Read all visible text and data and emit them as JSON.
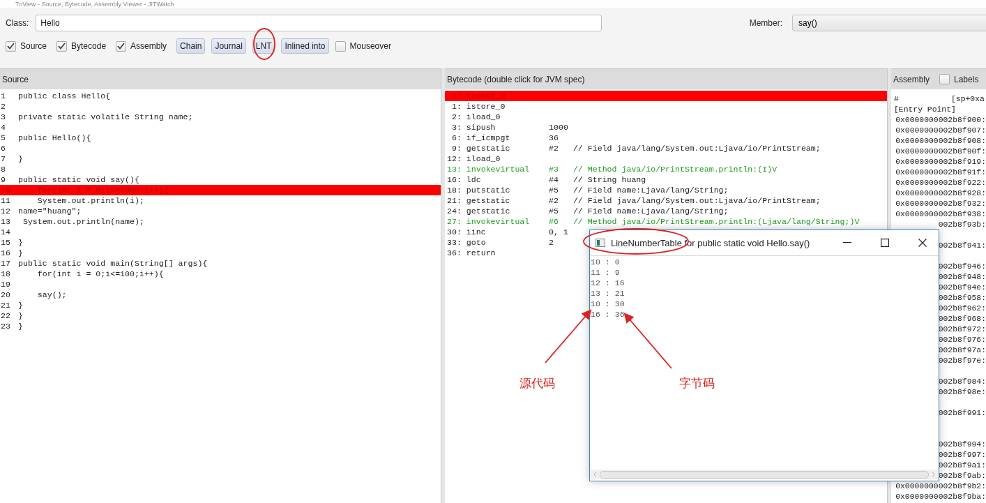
{
  "window": {
    "title": "TriView - Source, Bytecode, Assembly Viewer - JITWatch"
  },
  "toolbar": {
    "class_label": "Class:",
    "class_value": "Hello",
    "member_label": "Member:",
    "member_value": "say()",
    "options": [
      {
        "kind": "checkbox",
        "label": "Source",
        "checked": true
      },
      {
        "kind": "checkbox",
        "label": "Bytecode",
        "checked": true
      },
      {
        "kind": "checkbox",
        "label": "Assembly",
        "checked": true
      },
      {
        "kind": "button",
        "label": "Chain"
      },
      {
        "kind": "button",
        "label": "Journal"
      },
      {
        "kind": "button",
        "label": "LNT"
      },
      {
        "kind": "button",
        "label": "Inlined into"
      },
      {
        "kind": "checkbox",
        "label": "Mouseover",
        "checked": false
      }
    ]
  },
  "source": {
    "title": "Source",
    "lines": [
      {
        "number": "1",
        "code": "public class Hello{",
        "highlighted": false
      },
      {
        "number": "2",
        "highlighted": false
      },
      {
        "number": "3",
        "code": "private static volatile String name;",
        "highlighted": false
      },
      {
        "number": "4",
        "highlighted": false
      },
      {
        "number": "5",
        "code": "public Hello(){",
        "highlighted": false
      },
      {
        "number": "6",
        "highlighted": false
      },
      {
        "number": "7",
        "code": "}",
        "highlighted": false
      },
      {
        "number": "8",
        "highlighted": false
      },
      {
        "number": "9",
        "code": "public static void say(){",
        "highlighted": false
      },
      {
        "number": "10",
        "code": "    for(int i = 0;i<=1000;i++){",
        "highlighted": true
      },
      {
        "number": "11",
        "code": "    System.out.println(i);",
        "highlighted": false
      },
      {
        "number": "12",
        "code": "name=\"huang\";",
        "highlighted": false
      },
      {
        "number": "13",
        "code": " System.out.println(name);",
        "highlighted": false
      },
      {
        "number": "14",
        "highlighted": false
      },
      {
        "number": "15",
        "code": "}",
        "highlighted": false
      },
      {
        "number": "16",
        "code": "}",
        "highlighted": false
      },
      {
        "number": "17",
        "code": "public static void main(String[] args){",
        "highlighted": false
      },
      {
        "number": "18",
        "code": "    for(int i = 0;i<=100;i++){",
        "highlighted": false
      },
      {
        "number": "19",
        "highlighted": false
      },
      {
        "number": "20",
        "code": "    say();",
        "highlighted": false
      },
      {
        "number": "21",
        "code": "}",
        "highlighted": false
      },
      {
        "number": "22",
        "code": "}",
        "highlighted": false
      },
      {
        "number": "23",
        "code": "}",
        "highlighted": false
      }
    ]
  },
  "bytecode": {
    "title": "Bytecode (double click for JVM spec)",
    "lines": [
      {
        "kind": "plain",
        "text": " 0: iconst_0",
        "highlighted": true
      },
      {
        "kind": "plain",
        "text": " 1: istore_0",
        "highlighted": false
      },
      {
        "kind": "plain",
        "text": " 2: iload_0",
        "highlighted": false
      },
      {
        "kind": "plain",
        "text": " 3: sipush           1000",
        "highlighted": false
      },
      {
        "kind": "plain",
        "text": " 6: if_icmpgt        36",
        "highlighted": false
      },
      {
        "kind": "plain",
        "text": " 9: getstatic        #2   // Field java/lang/System.out:Ljava/io/PrintStream;",
        "highlighted": false
      },
      {
        "kind": "plain",
        "text": "12: iload_0",
        "highlighted": false
      },
      {
        "kind": "invoke",
        "text": "13: invokevirtual    #3   // Method java/io/PrintStream.println:(I)V",
        "highlighted": false
      },
      {
        "kind": "plain",
        "text": "16: ldc              #4   // String huang",
        "highlighted": false
      },
      {
        "kind": "plain",
        "text": "18: putstatic        #5   // Field name:Ljava/lang/String;",
        "highlighted": false
      },
      {
        "kind": "plain",
        "text": "21: getstatic        #2   // Field java/lang/System.out:Ljava/io/PrintStream;",
        "highlighted": false
      },
      {
        "kind": "plain",
        "text": "24: getstatic        #5   // Field name:Ljava/lang/String;",
        "highlighted": false
      },
      {
        "kind": "invoke",
        "text": "27: invokevirtual    #6   // Method java/io/PrintStream.println:(Ljava/lang/String;)V",
        "highlighted": false
      },
      {
        "kind": "plain",
        "text": "30: iinc             0, 1",
        "highlighted": false
      },
      {
        "kind": "plain",
        "text": "33: goto             2",
        "highlighted": false
      },
      {
        "kind": "plain",
        "text": "36: return",
        "highlighted": false
      }
    ]
  },
  "assembly": {
    "title": "Assembly",
    "labels_option": {
      "label": "Labels",
      "checked": false
    },
    "lines": [
      {
        "kind": "text",
        "text": "#           [sp+0xa"
      },
      {
        "kind": "text",
        "text": "[Entry Point]"
      },
      {
        "kind": "address",
        "text": "0x0000000002b8f900:"
      },
      {
        "kind": "address",
        "text": "0x0000000002b8f907:"
      },
      {
        "kind": "address",
        "text": "0x0000000002b8f908:"
      },
      {
        "kind": "address",
        "text": "0x0000000002b8f90f:"
      },
      {
        "kind": "address",
        "text": "0x0000000002b8f919:"
      },
      {
        "kind": "address",
        "text": "0x0000000002b8f91f:"
      },
      {
        "kind": "address",
        "text": "0x0000000002b8f922:"
      },
      {
        "kind": "address",
        "text": "0x0000000002b8f928:"
      },
      {
        "kind": "address",
        "text": "0x0000000002b8f932:"
      },
      {
        "kind": "address",
        "text": "0x0000000002b8f938:"
      },
      {
        "kind": "address",
        "text": "002b8f93b:"
      },
      {
        "kind": "blank"
      },
      {
        "kind": "address",
        "text": "002b8f941:"
      },
      {
        "kind": "blank"
      },
      {
        "kind": "address",
        "text": "002b8f946:"
      },
      {
        "kind": "address",
        "text": "002b8f948:"
      },
      {
        "kind": "address",
        "text": "002b8f94e:"
      },
      {
        "kind": "address",
        "text": "002b8f958:"
      },
      {
        "kind": "address",
        "text": "002b8f962:"
      },
      {
        "kind": "address",
        "text": "002b8f968:"
      },
      {
        "kind": "address",
        "text": "002b8f972:"
      },
      {
        "kind": "address",
        "text": "002b8f976:"
      },
      {
        "kind": "address",
        "text": "002b8f97a:"
      },
      {
        "kind": "address",
        "text": "002b8f97e:"
      },
      {
        "kind": "blank"
      },
      {
        "kind": "address",
        "text": "002b8f984:"
      },
      {
        "kind": "address",
        "text": "002b8f98e:"
      },
      {
        "kind": "blank"
      },
      {
        "kind": "address",
        "text": "002b8f991:"
      },
      {
        "kind": "blank"
      },
      {
        "kind": "blank"
      },
      {
        "kind": "address",
        "text": "002b8f994:"
      },
      {
        "kind": "address",
        "text": "002b8f997:"
      },
      {
        "kind": "address",
        "text": "002b8f9a1:"
      },
      {
        "kind": "address",
        "text": "002b8f9ab:"
      },
      {
        "kind": "address",
        "text": "0x0000000002b8f9b2:"
      },
      {
        "kind": "address",
        "text": "0x0000000002b8f9ba:"
      }
    ]
  },
  "popup": {
    "title": "LineNumberTable for public static void Hello.say()",
    "lines": [
      "10 : 0",
      "11 : 9",
      "12 : 16",
      "13 : 21",
      "10 : 30",
      "16 : 36"
    ]
  },
  "annotations": {
    "source_label": "源代码",
    "bytecode_label": "字节码"
  }
}
